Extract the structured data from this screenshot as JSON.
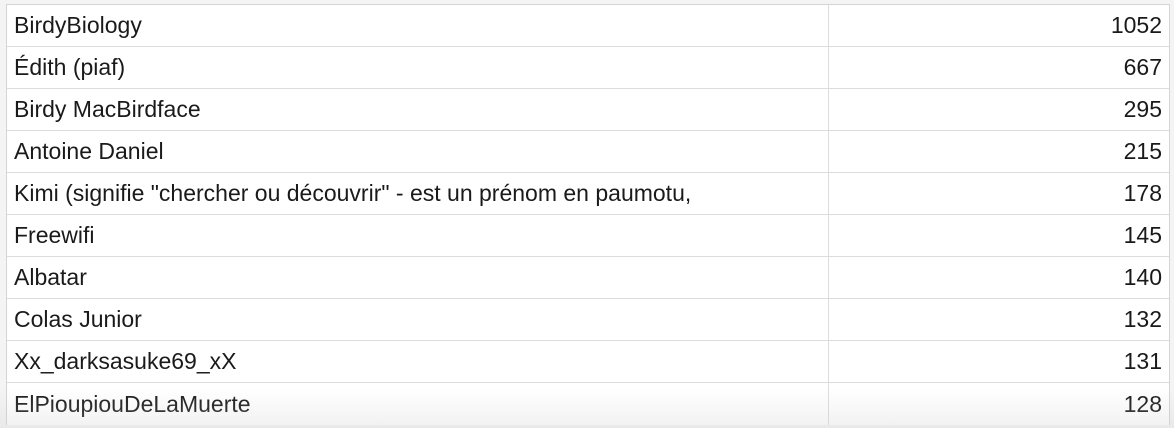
{
  "rows": [
    {
      "name": "BirdyBiology",
      "count": "1052"
    },
    {
      "name": "Édith (piaf)",
      "count": "667"
    },
    {
      "name": "Birdy MacBirdface",
      "count": "295"
    },
    {
      "name": "Antoine Daniel",
      "count": "215"
    },
    {
      "name": "Kimi (signifie \"chercher ou découvrir\" - est un prénom en paumotu,",
      "count": "178"
    },
    {
      "name": "Freewifi",
      "count": "145"
    },
    {
      "name": "Albatar",
      "count": "140"
    },
    {
      "name": "Colas Junior",
      "count": "132"
    },
    {
      "name": "Xx_darksasuke69_xX",
      "count": "131"
    },
    {
      "name": "ElPioupiouDeLaMuerte",
      "count": "128"
    }
  ]
}
